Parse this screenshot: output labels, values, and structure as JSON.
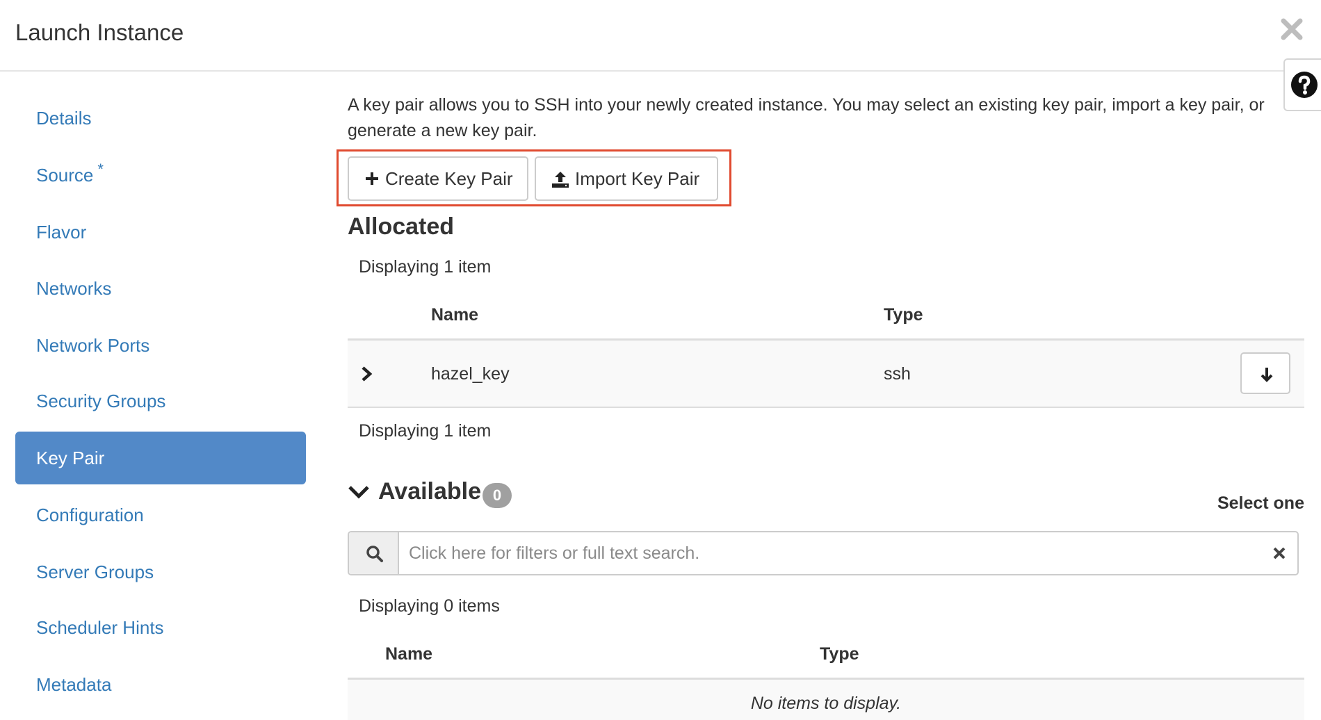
{
  "modal": {
    "title": "Launch Instance"
  },
  "sidebar": {
    "items": [
      {
        "label": "Details",
        "required": false,
        "active": false
      },
      {
        "label": "Source",
        "required": true,
        "active": false
      },
      {
        "label": "Flavor",
        "required": false,
        "active": false
      },
      {
        "label": "Networks",
        "required": false,
        "active": false
      },
      {
        "label": "Network Ports",
        "required": false,
        "active": false
      },
      {
        "label": "Security Groups",
        "required": false,
        "active": false
      },
      {
        "label": "Key Pair",
        "required": false,
        "active": true
      },
      {
        "label": "Configuration",
        "required": false,
        "active": false
      },
      {
        "label": "Server Groups",
        "required": false,
        "active": false
      },
      {
        "label": "Scheduler Hints",
        "required": false,
        "active": false
      },
      {
        "label": "Metadata",
        "required": false,
        "active": false
      }
    ],
    "required_marker": "*"
  },
  "main": {
    "intro": "A key pair allows you to SSH into your newly created instance. You may select an existing key pair, import a key pair, or generate a new key pair.",
    "create_button": "Create Key Pair",
    "import_button": "Import Key Pair",
    "allocated": {
      "title": "Allocated",
      "count_top": "Displaying 1 item",
      "count_bottom": "Displaying 1 item",
      "columns": [
        "Name",
        "Type"
      ],
      "rows": [
        {
          "name": "hazel_key",
          "type": "ssh"
        }
      ]
    },
    "available": {
      "title": "Available",
      "badge": "0",
      "select_hint": "Select one",
      "search_placeholder": "Click here for filters or full text search.",
      "count": "Displaying 0 items",
      "columns": [
        "Name",
        "Type"
      ],
      "empty_message": "No items to display."
    }
  },
  "colors": {
    "accent": "#5289c8",
    "link": "#337ab7",
    "highlight": "#e04a2f"
  }
}
